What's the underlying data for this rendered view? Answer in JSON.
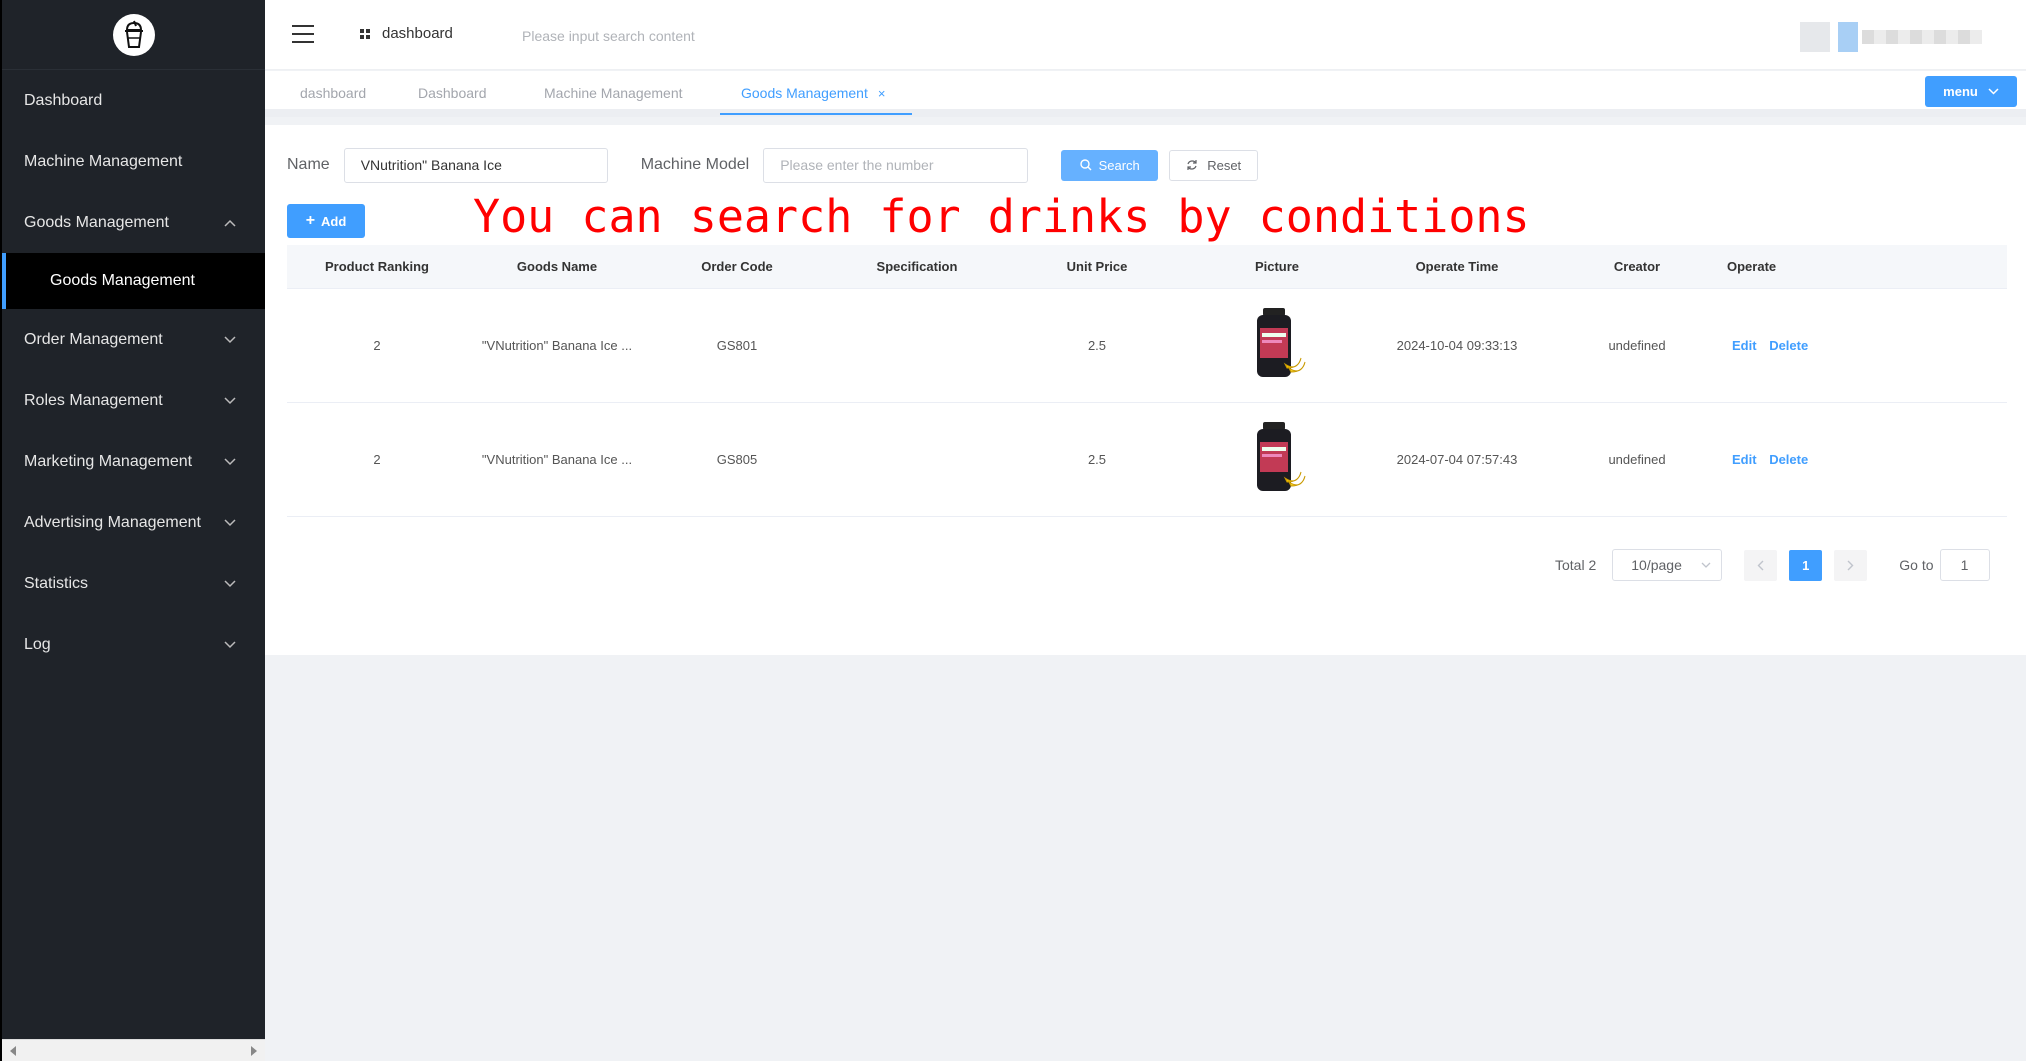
{
  "sidebar": {
    "items": [
      {
        "label": "Dashboard"
      },
      {
        "label": "Machine Management"
      },
      {
        "label": "Goods Management"
      },
      {
        "label": "Order Management"
      },
      {
        "label": "Roles Management"
      },
      {
        "label": "Marketing Management"
      },
      {
        "label": "Advertising Management"
      },
      {
        "label": "Statistics"
      },
      {
        "label": "Log"
      }
    ],
    "submenu": {
      "label": "Goods Management"
    }
  },
  "header": {
    "breadcrumb": "dashboard",
    "search_placeholder": "Please input search content"
  },
  "tabs": [
    {
      "label": "dashboard"
    },
    {
      "label": "Dashboard"
    },
    {
      "label": "Machine Management"
    },
    {
      "label": "Goods Management",
      "close": "×"
    }
  ],
  "menu_button": "menu",
  "form": {
    "name_label": "Name",
    "name_value": "VNutrition\" Banana Ice",
    "model_label": "Machine Model",
    "model_placeholder": "Please enter the number",
    "search_label": "Search",
    "reset_label": "Reset",
    "add_label": "Add"
  },
  "annotation": "You can search for drinks by conditions",
  "table": {
    "headers": [
      "Product Ranking",
      "Goods Name",
      "Order Code",
      "Specification",
      "Unit Price",
      "Picture",
      "Operate Time",
      "Creator",
      "Operate"
    ],
    "rows": [
      {
        "ranking": "2",
        "name": "\"VNutrition\" Banana Ice ...",
        "code": "GS801",
        "spec": "",
        "price": "2.5",
        "time": "2024-10-04 09:33:13",
        "creator": "undefined"
      },
      {
        "ranking": "2",
        "name": "\"VNutrition\" Banana Ice ...",
        "code": "GS805",
        "spec": "",
        "price": "2.5",
        "time": "2024-07-04 07:57:43",
        "creator": "undefined"
      }
    ],
    "edit_label": "Edit",
    "delete_label": "Delete"
  },
  "pagination": {
    "total": "Total 2",
    "page_size": "10/page",
    "current_page": "1",
    "goto_label": "Go to",
    "goto_value": "1"
  },
  "colors": {
    "primary": "#409eff",
    "sidebar_bg": "#1f2329",
    "annotation": "#ff0000"
  }
}
